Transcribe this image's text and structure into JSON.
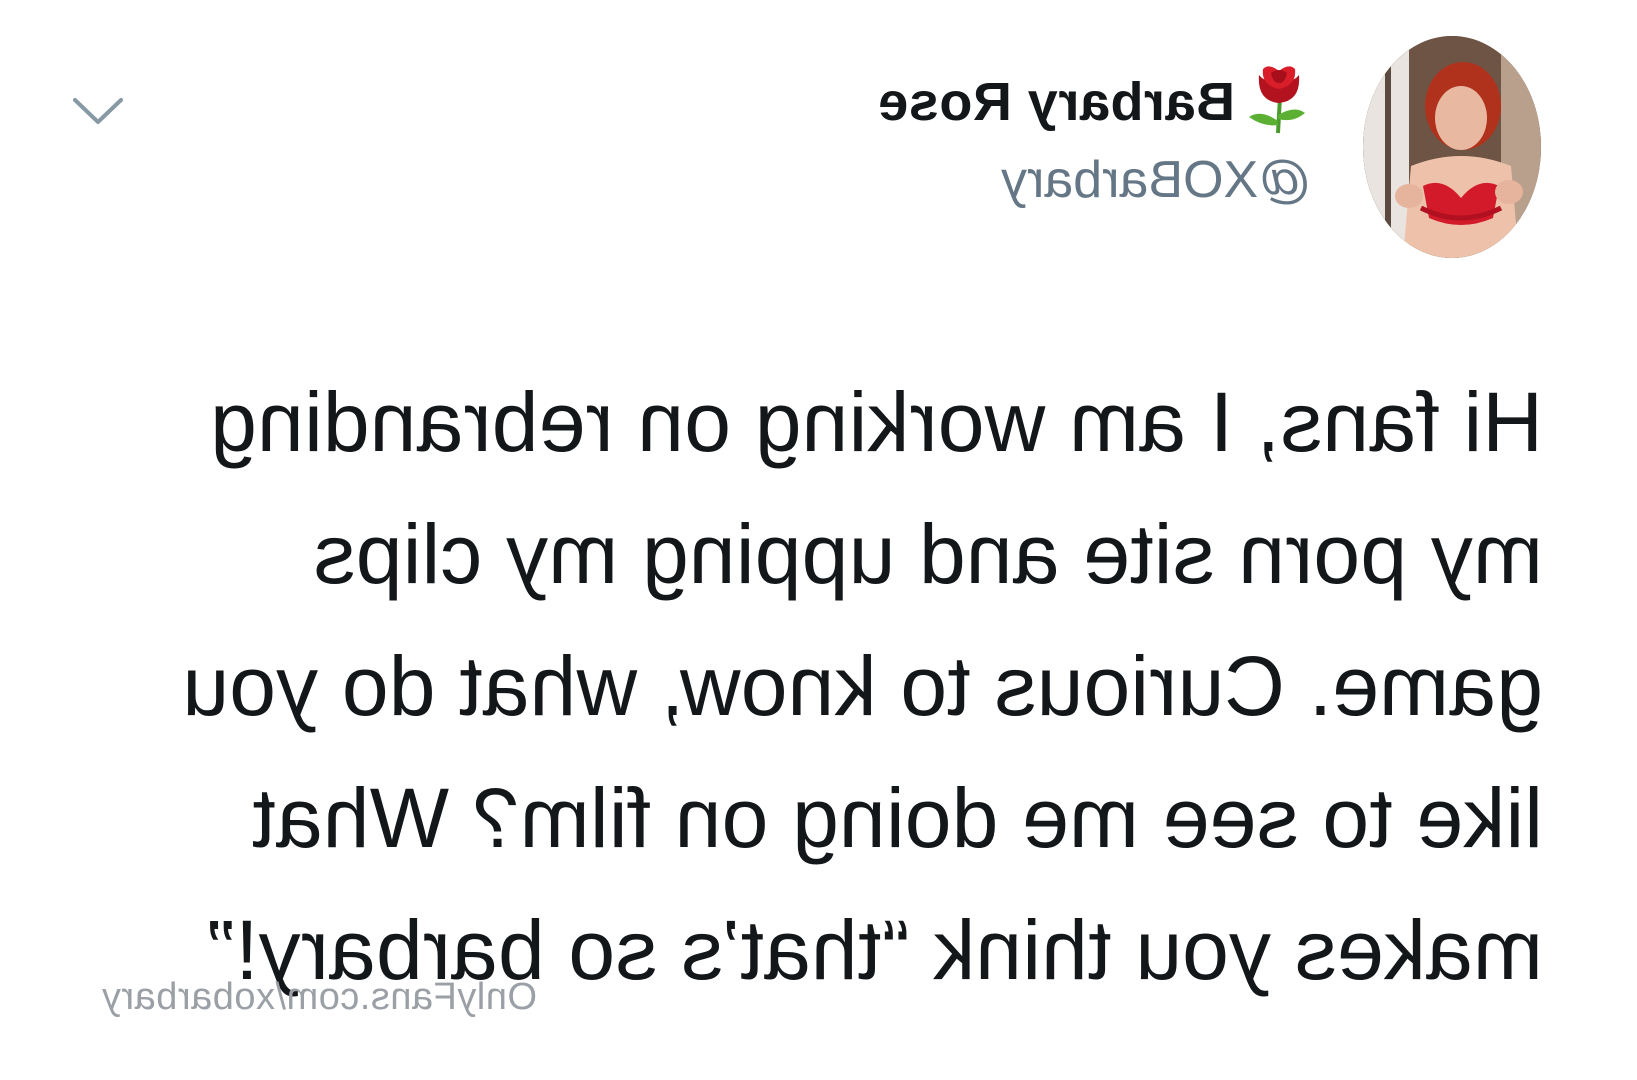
{
  "tweet": {
    "display_name": "Barbary Rose",
    "name_emoji": "rose-icon",
    "handle": "@XOBarbary",
    "text_lines": [
      "Hi fans, I am working on rebranding",
      "my porn site and upping my clips",
      "game. Curious to know, what do you",
      "like to see me doing on film? What",
      "makes you think “that’s so barbary!”"
    ]
  },
  "watermark": "OnlyFans.com/xobarbary",
  "mirrored": true,
  "colors": {
    "text": "#14171a",
    "secondary": "#657786",
    "watermark": "#9aa0a6",
    "rose": "#c8102e",
    "stem": "#4a9a2e"
  }
}
